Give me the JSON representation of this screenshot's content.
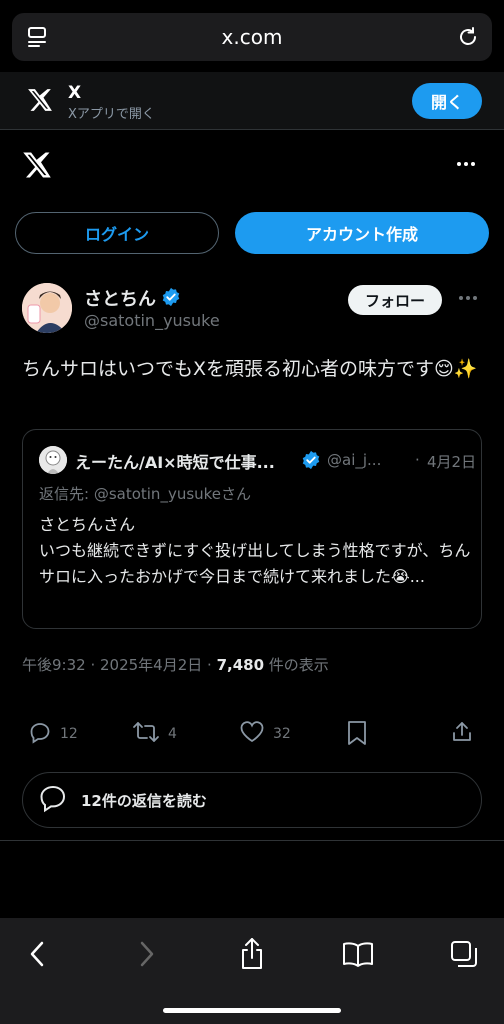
{
  "browser": {
    "url": "x.com"
  },
  "banner": {
    "app_name": "X",
    "subtitle": "Xアプリで開く",
    "open_label": "開く"
  },
  "auth": {
    "login_label": "ログイン",
    "signup_label": "アカウント作成"
  },
  "tweet": {
    "author_name": "さとちん",
    "author_handle": "@satotin_yusuke",
    "follow_label": "フォロー",
    "text": "ちんサロはいつでもXを頑張る初心者の味方です😌✨",
    "quote": {
      "author_name": "えーたん/AI×時短で仕事...",
      "author_handle": "@ai_j...",
      "separator": "·",
      "date": "4月2日",
      "reply_to": "返信先: @satotin_yusukeさん",
      "text": "さとちんさん\nいつも継続できずにすぐ投げ出してしまう性格ですが、ちんサロに入ったおかげで今日まで続けて来れました😭..."
    },
    "meta": {
      "time_date": "午後9:32 · 2025年4月2日 · ",
      "views": "7,480",
      "views_suffix": " 件の表示"
    },
    "actions": {
      "replies": "12",
      "retweets": "4",
      "likes": "32"
    },
    "read_replies_label": "12件の返信を読む"
  },
  "colors": {
    "accent": "#1d9bf0",
    "background": "#000000",
    "muted": "#71767b",
    "border": "#2f3336"
  },
  "icons": {
    "url_left": "reader-icon",
    "url_right": "reload-icon",
    "bottom": [
      "back-icon",
      "forward-icon",
      "share-icon",
      "bookmarks-icon",
      "tabs-icon"
    ]
  }
}
